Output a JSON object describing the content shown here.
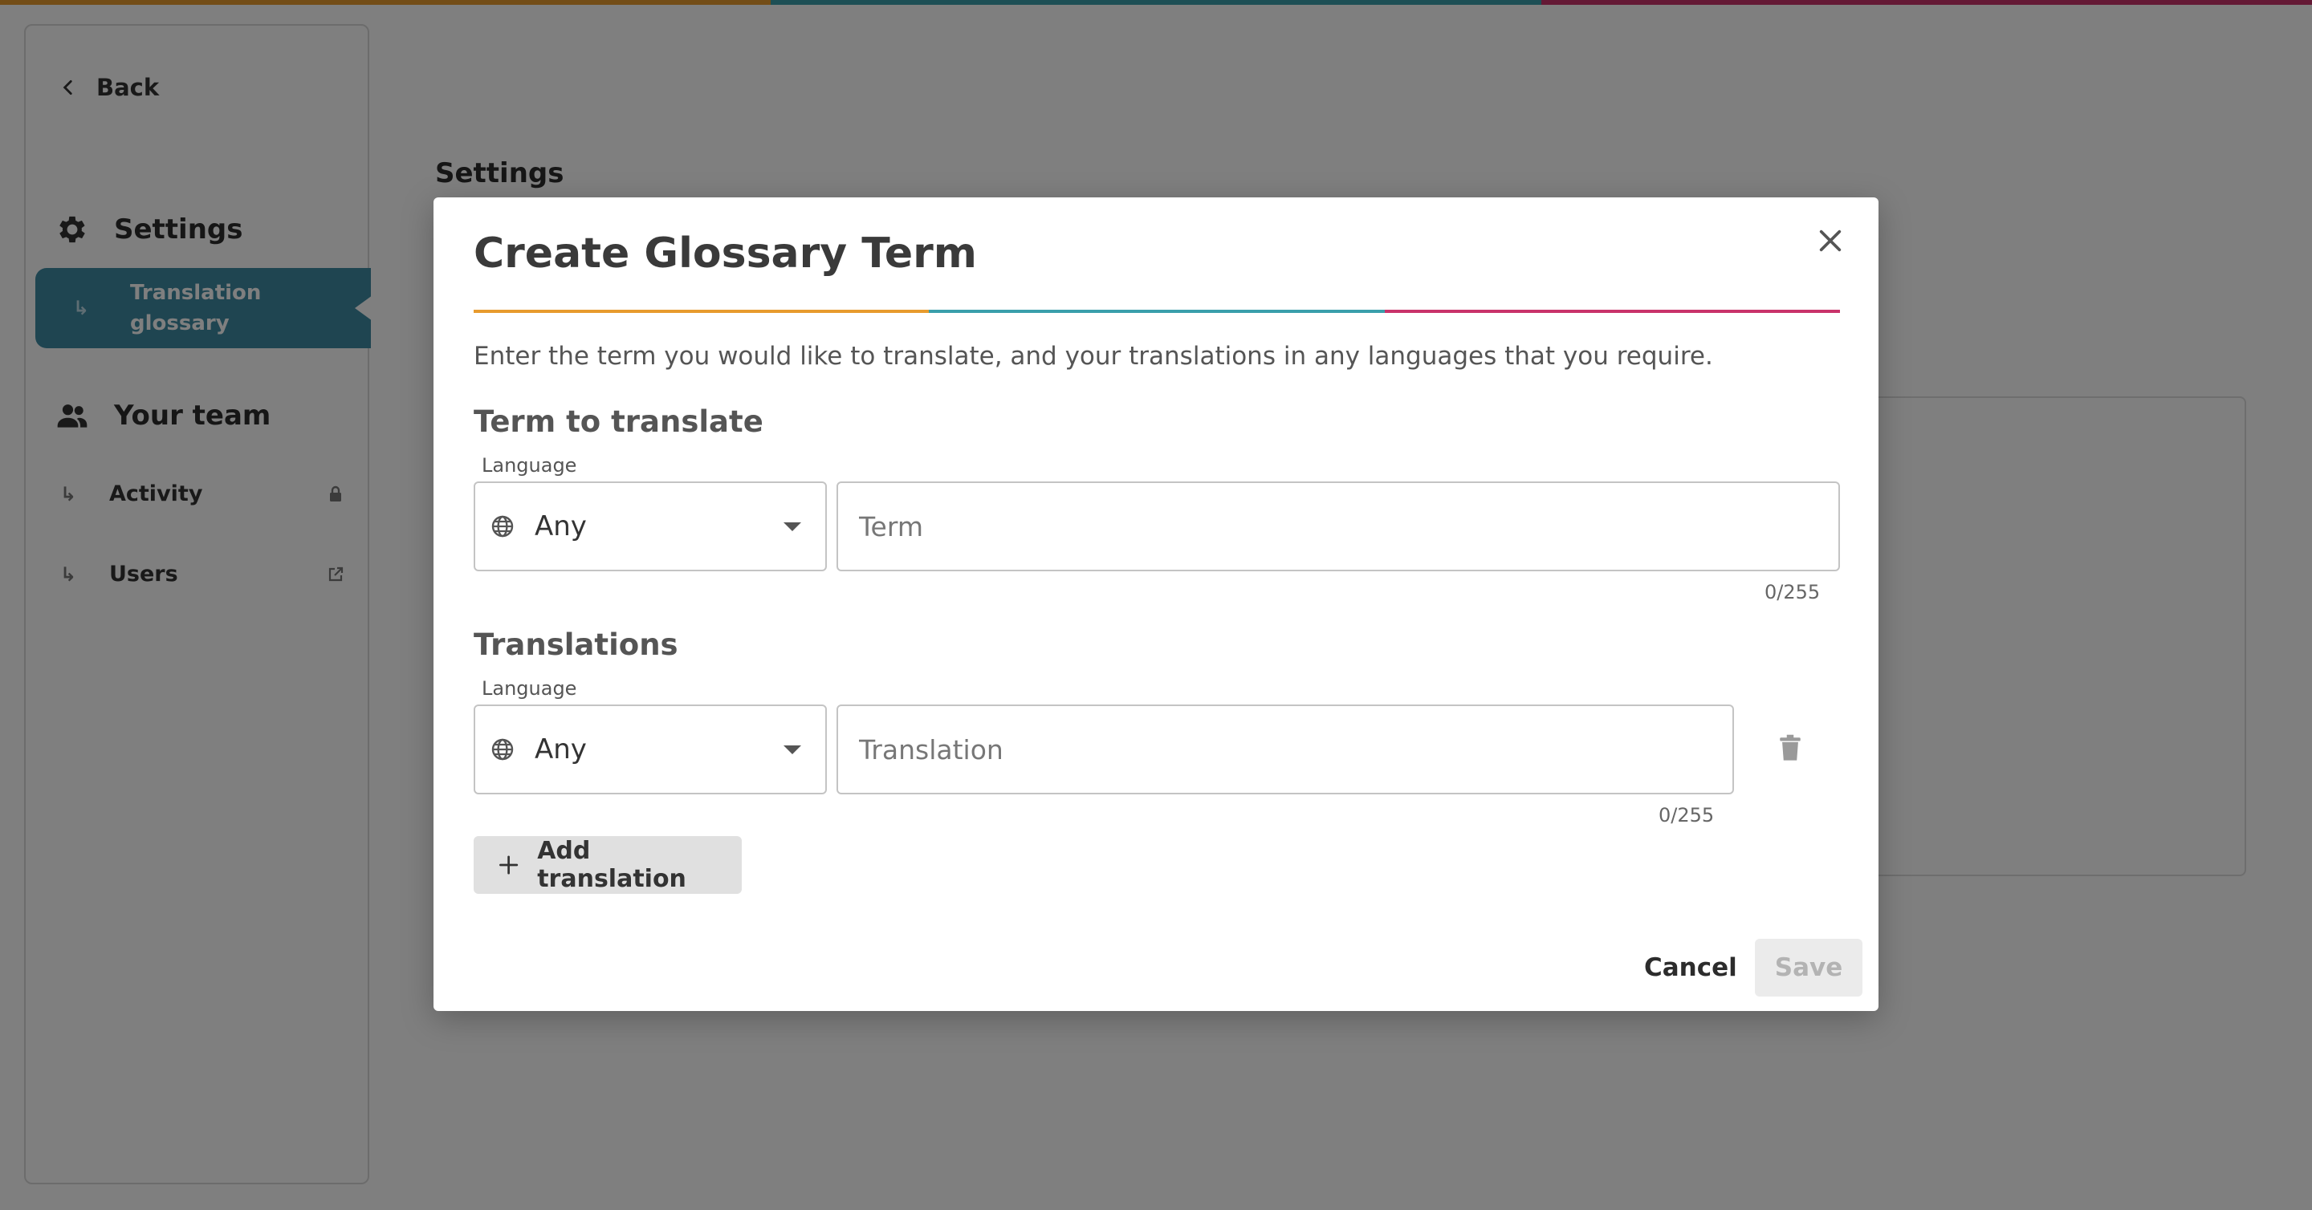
{
  "colors": {
    "stripe": [
      "#e79b2e",
      "#3a9fab",
      "#c9336a"
    ],
    "sidebar_active": "#3e8ba3",
    "add_button_bg": "#e0e0e0",
    "save_button_bg": "#ebebeb",
    "save_button_text": "#b3b3b3"
  },
  "sidebar": {
    "back_label": "Back",
    "back_icon": "chevron-left-icon",
    "settings": {
      "label": "Settings",
      "icon": "gear-icon"
    },
    "active_item": {
      "label_line1": "Translation",
      "label_line2": "glossary"
    },
    "team": {
      "label": "Your team",
      "icon": "people-icon"
    },
    "items": [
      {
        "label": "Activity",
        "icon": "lock-icon"
      },
      {
        "label": "Users",
        "icon": "external-link-icon"
      }
    ],
    "sub_arrow": "↳"
  },
  "background": {
    "page_title": "Settings"
  },
  "modal": {
    "title": "Create Glossary Term",
    "description": "Enter the term you would like to translate, and your translations in any languages that you require.",
    "term_section": {
      "heading": "Term to translate",
      "language_label": "Language",
      "language_value": "Any",
      "term_placeholder": "Term",
      "counter": "0/255"
    },
    "translations_section": {
      "heading": "Translations",
      "language_label": "Language",
      "language_value": "Any",
      "translation_placeholder": "Translation",
      "counter": "0/255"
    },
    "add_translation_label": "Add translation",
    "cancel_label": "Cancel",
    "save_label": "Save"
  }
}
